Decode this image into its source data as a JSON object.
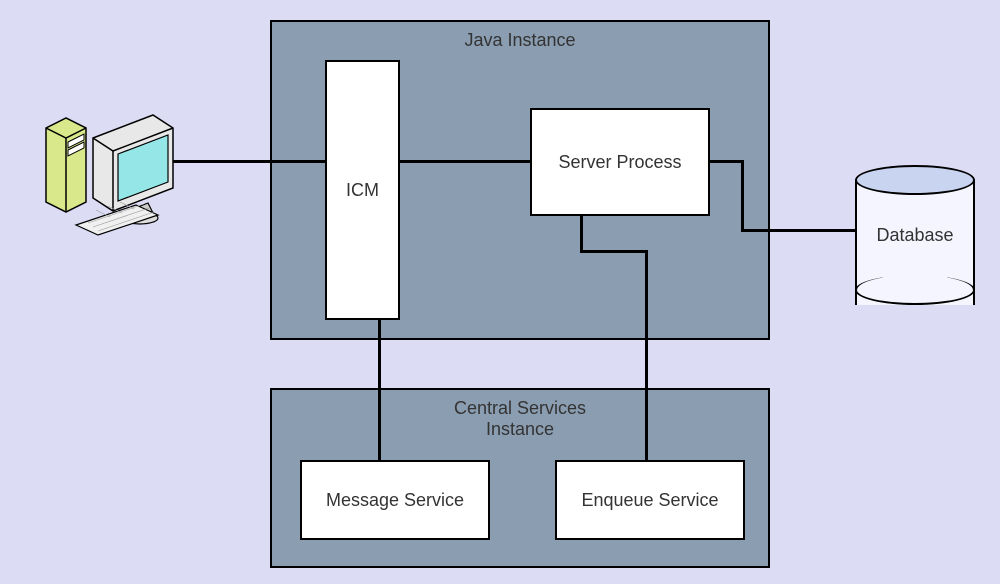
{
  "diagram": {
    "java_instance_label": "Java Instance",
    "central_services_label": "Central Services Instance",
    "icm_label": "ICM",
    "server_process_label": "Server Process",
    "message_service_label": "Message Service",
    "enqueue_service_label": "Enqueue Service",
    "database_label": "Database"
  },
  "layout": {
    "nodes": [
      {
        "id": "workstation",
        "type": "icon"
      },
      {
        "id": "java_instance",
        "type": "container"
      },
      {
        "id": "icm",
        "type": "component",
        "parent": "java_instance"
      },
      {
        "id": "server_process",
        "type": "component",
        "parent": "java_instance"
      },
      {
        "id": "central_services",
        "type": "container"
      },
      {
        "id": "message_service",
        "type": "component",
        "parent": "central_services"
      },
      {
        "id": "enqueue_service",
        "type": "component",
        "parent": "central_services"
      },
      {
        "id": "database",
        "type": "datastore"
      }
    ],
    "edges": [
      {
        "from": "workstation",
        "to": "icm"
      },
      {
        "from": "icm",
        "to": "server_process"
      },
      {
        "from": "server_process",
        "to": "database"
      },
      {
        "from": "icm",
        "to": "message_service"
      },
      {
        "from": "server_process",
        "to": "enqueue_service"
      }
    ]
  }
}
